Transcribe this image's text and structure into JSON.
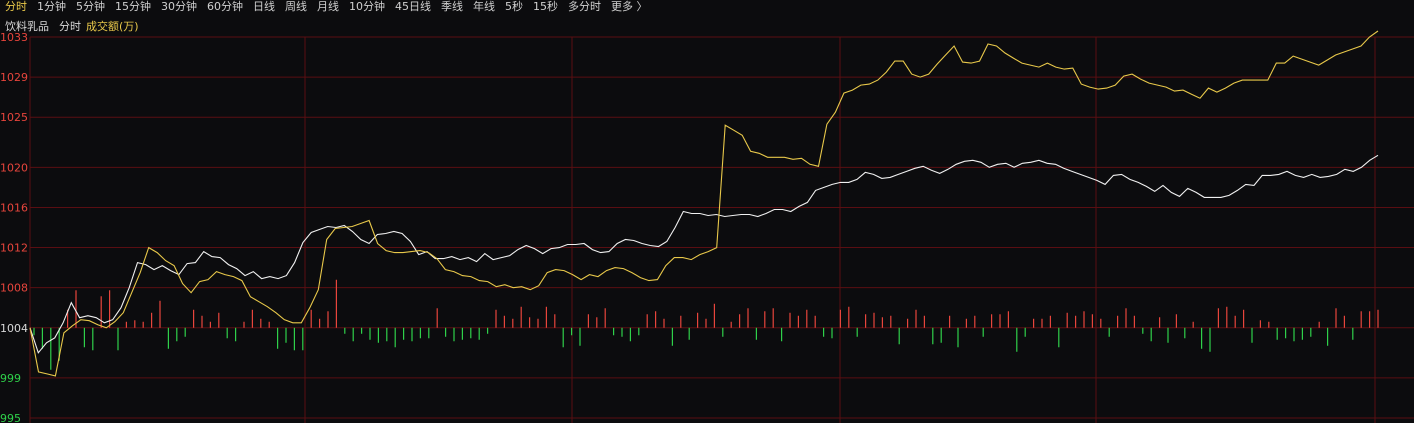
{
  "toolbar": {
    "items": [
      "分时",
      "1分钟",
      "5分钟",
      "15分钟",
      "30分钟",
      "60分钟",
      "日线",
      "周线",
      "月线",
      "10分钟",
      "45日线",
      "季线",
      "年线",
      "5秒",
      "15秒",
      "多分时",
      "更多 〉"
    ],
    "active_index": 0
  },
  "chart_header": {
    "name": "饮料乳品",
    "mode": "分时",
    "volume_label": "成交额(万)"
  },
  "colors": {
    "background": "#0c0c0e",
    "grid": "#5a0e12",
    "price_line": "#f0f0f0",
    "avg_line": "#e8c84a",
    "up_bar": "#e8453c",
    "down_bar": "#2fd14a",
    "axis_up_text": "#e8453c",
    "axis_down_text": "#2fd14a",
    "axis_base_text": "#d8d8d8",
    "active_tab": "#e8c84a"
  },
  "chart_data": {
    "type": "line",
    "ylim": [
      995,
      1033
    ],
    "base_price": 1004,
    "y_ticks": [
      "1033",
      "1029",
      "1025",
      "1020",
      "1016",
      "1012",
      "1008",
      "1004",
      "999",
      "995"
    ],
    "grid": true,
    "series": [
      {
        "key": "price",
        "values": [
          1004,
          1001.5,
          1002.5,
          1003,
          1004.5,
          1006.5,
          1005,
          1005.2,
          1005,
          1004.5,
          1004.8,
          1006,
          1008,
          1010.5,
          1010.3,
          1009.8,
          1010.2,
          1009.7,
          1009.3,
          1010.4,
          1010.5,
          1011.6,
          1011.1,
          1011,
          1010.3,
          1009.9,
          1009.2,
          1009.6,
          1008.9,
          1009.1,
          1008.9,
          1009.2,
          1010.5,
          1012.5,
          1013.5,
          1013.8,
          1014.1,
          1014,
          1014.2,
          1013.6,
          1012.8,
          1012.4,
          1013.3,
          1013.4,
          1013.6,
          1013.4,
          1012.6,
          1011.3,
          1011.6,
          1010.9,
          1010.9,
          1011.1,
          1010.8,
          1011,
          1010.6,
          1011.4,
          1010.8,
          1011,
          1011.2,
          1011.8,
          1012.2,
          1011.9,
          1011.4,
          1011.9,
          1012,
          1012.3,
          1012.3,
          1012.4,
          1011.8,
          1011.5,
          1011.6,
          1012.4,
          1012.8,
          1012.7,
          1012.4,
          1012.2,
          1012.1,
          1012.6,
          1014,
          1015.6,
          1015.4,
          1015.4,
          1015.2,
          1015.3,
          1015.1,
          1015.2,
          1015.3,
          1015.3,
          1015.1,
          1015.4,
          1015.8,
          1015.8,
          1015.6,
          1016.1,
          1016.5,
          1017.7,
          1018,
          1018.3,
          1018.5,
          1018.5,
          1018.8,
          1019.5,
          1019.3,
          1018.9,
          1019,
          1019.3,
          1019.6,
          1019.9,
          1020.1,
          1019.7,
          1019.4,
          1019.8,
          1020.3,
          1020.6,
          1020.7,
          1020.5,
          1020,
          1020.3,
          1020.4,
          1020,
          1020.4,
          1020.5,
          1020.7,
          1020.4,
          1020.3,
          1019.9,
          1019.6,
          1019.3,
          1019,
          1018.7,
          1018.3,
          1019.2,
          1019.3,
          1018.8,
          1018.5,
          1018.1,
          1017.6,
          1018.2,
          1017.5,
          1017.1,
          1017.9,
          1017.5,
          1017,
          1017,
          1017,
          1017.2,
          1017.7,
          1018.3,
          1018.2,
          1019.2,
          1019.2,
          1019.3,
          1019.6,
          1019.2,
          1019,
          1019.3,
          1019,
          1019.1,
          1019.3,
          1019.8,
          1019.6,
          1020,
          1020.7,
          1021.2
        ]
      },
      {
        "key": "average",
        "values": [
          1004,
          999.6,
          999.4,
          999.2,
          1003.5,
          1004.2,
          1004.8,
          1004.7,
          1004.3,
          1004,
          1004.6,
          1005.5,
          1007.5,
          1009.5,
          1012,
          1011.5,
          1010.7,
          1010.2,
          1008.4,
          1007.5,
          1008.6,
          1008.8,
          1009.6,
          1009.3,
          1009.1,
          1008.7,
          1007.1,
          1006.6,
          1006.1,
          1005.5,
          1004.8,
          1004.5,
          1004.5,
          1006,
          1007.8,
          1012.8,
          1013.9,
          1014,
          1014.1,
          1014.4,
          1014.7,
          1012.4,
          1011.7,
          1011.5,
          1011.5,
          1011.6,
          1011.7,
          1011.5,
          1010.9,
          1009.8,
          1009.6,
          1009.2,
          1009.1,
          1008.7,
          1008.6,
          1008.1,
          1008.3,
          1008,
          1008.1,
          1007.8,
          1008.2,
          1009.5,
          1009.8,
          1009.7,
          1009.3,
          1008.8,
          1009.3,
          1009.1,
          1009.7,
          1010,
          1009.9,
          1009.5,
          1009,
          1008.7,
          1008.8,
          1010.2,
          1011,
          1011,
          1010.8,
          1011.3,
          1011.6,
          1012,
          1024.2,
          1023.7,
          1023.2,
          1021.6,
          1021.4,
          1021,
          1021,
          1021,
          1020.8,
          1020.9,
          1020.3,
          1020.1,
          1024.3,
          1025.5,
          1027.4,
          1027.7,
          1028.2,
          1028.3,
          1028.7,
          1029.5,
          1030.6,
          1030.6,
          1029.3,
          1029,
          1029.3,
          1030.3,
          1031.2,
          1032.1,
          1030.5,
          1030.4,
          1030.6,
          1032.3,
          1032.1,
          1031.4,
          1030.9,
          1030.4,
          1030.2,
          1030,
          1030.4,
          1030,
          1029.8,
          1029.9,
          1028.3,
          1028,
          1027.8,
          1027.9,
          1028.2,
          1029.1,
          1029.3,
          1028.8,
          1028.4,
          1028.2,
          1028,
          1027.6,
          1027.7,
          1027.3,
          1026.9,
          1027.9,
          1027.5,
          1027.9,
          1028.4,
          1028.7,
          1028.7,
          1028.7,
          1028.7,
          1030.4,
          1030.4,
          1031.1,
          1030.8,
          1030.5,
          1030.2,
          1030.7,
          1031.2,
          1031.5,
          1031.8,
          1032.1,
          1033,
          1033.6
        ]
      }
    ],
    "volume": {
      "direction": [
        -1,
        -1,
        -1,
        -1,
        1,
        1,
        -1,
        -1,
        1,
        1,
        -1,
        1,
        1,
        1,
        1,
        1,
        -1,
        -1,
        -1,
        1,
        1,
        1,
        1,
        -1,
        -1,
        1,
        1,
        1,
        1,
        -1,
        -1,
        -1,
        -1,
        1,
        1,
        1,
        1,
        -1,
        -1,
        -1,
        -1,
        -1,
        -1,
        -1,
        -1,
        -1,
        -1,
        -1,
        1,
        -1,
        -1,
        -1,
        -1,
        -1,
        -1,
        1,
        1,
        1,
        1,
        1,
        1,
        1,
        1,
        -1,
        -1,
        -1,
        1,
        1,
        1,
        -1,
        -1,
        -1,
        -1,
        1,
        1,
        1,
        -1,
        1,
        -1,
        1,
        1,
        1,
        -1,
        1,
        1,
        1,
        -1,
        1,
        1,
        -1,
        1,
        1,
        1,
        1,
        -1,
        -1,
        1,
        1,
        -1,
        1,
        1,
        1,
        1,
        -1,
        1,
        1,
        1,
        -1,
        -1,
        1,
        -1,
        1,
        1,
        -1,
        1,
        1,
        1,
        -1,
        -1,
        1,
        1,
        1,
        -1,
        1,
        1,
        1,
        1,
        1,
        -1,
        1,
        1,
        1,
        -1,
        -1,
        1,
        -1,
        1,
        -1,
        1,
        -1,
        -1,
        1,
        1,
        1,
        1,
        -1,
        1,
        1,
        -1,
        -1,
        -1,
        -1,
        -1,
        1,
        -1,
        1,
        1,
        -1,
        1,
        1,
        1
      ],
      "magnitude": [
        0.5,
        1.4,
        2.8,
        2.2,
        1.2,
        2.5,
        1.3,
        1.5,
        2.1,
        2.5,
        1.5,
        0.4,
        0.5,
        0.4,
        1.0,
        1.8,
        1.4,
        0.9,
        0.6,
        1.2,
        0.8,
        0.4,
        1.0,
        0.7,
        0.9,
        0.4,
        1.2,
        0.6,
        0.4,
        1.4,
        1.0,
        1.5,
        1.5,
        1.2,
        0.6,
        1.1,
        3.2,
        0.4,
        0.9,
        0.4,
        0.8,
        1.0,
        0.9,
        1.3,
        0.8,
        0.9,
        0.7,
        0.7,
        1.3,
        0.6,
        0.9,
        0.8,
        0.7,
        0.8,
        0.4,
        1.2,
        0.8,
        0.6,
        1.4,
        0.7,
        0.6,
        1.4,
        0.9,
        1.3,
        0.5,
        1.2,
        0.9,
        0.7,
        1.3,
        0.5,
        0.6,
        0.9,
        0.5,
        0.9,
        1.1,
        0.6,
        1.2,
        0.8,
        0.8,
        1.0,
        0.6,
        1.6,
        0.6,
        0.4,
        0.9,
        1.3,
        0.8,
        1.1,
        1.3,
        0.9,
        1.0,
        0.8,
        1.2,
        0.8,
        0.6,
        0.7,
        1.2,
        1.4,
        0.6,
        0.9,
        1.0,
        0.7,
        0.8,
        1.1,
        0.6,
        1.2,
        0.8,
        1.1,
        1.0,
        0.8,
        1.3,
        0.6,
        0.8,
        0.6,
        0.9,
        0.9,
        1.1,
        1.6,
        0.6,
        0.6,
        0.6,
        0.8,
        1.3,
        1.0,
        0.8,
        1.1,
        0.9,
        0.6,
        0.6,
        0.8,
        1.3,
        0.8,
        0.4,
        0.9,
        0.7,
        1.0,
        0.9,
        0.7,
        0.4,
        1.4,
        1.6,
        1.3,
        1.4,
        0.8,
        1.2,
        1.0,
        0.5,
        0.4,
        0.8,
        0.7,
        0.9,
        0.8,
        0.6,
        0.4,
        1.2,
        1.3,
        0.8,
        0.8,
        1.1,
        1.1,
        1.2,
        0.4,
        0.9,
        1.3,
        1.3
      ]
    }
  }
}
